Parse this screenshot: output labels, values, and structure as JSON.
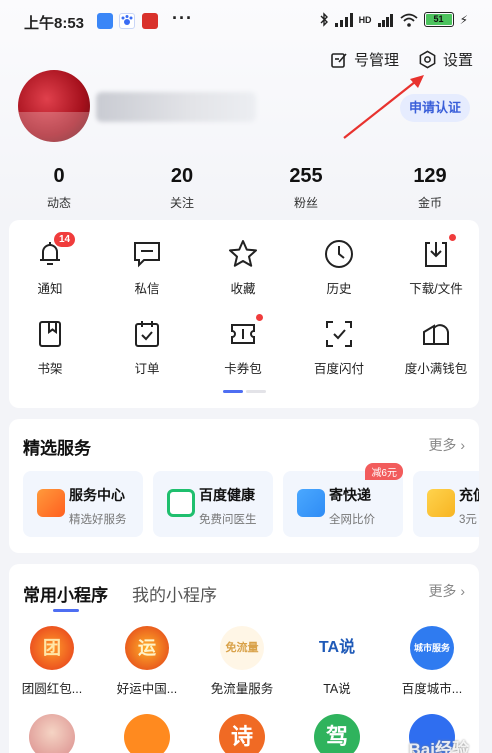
{
  "status_bar": {
    "time": "上午8:53",
    "dots": "···",
    "battery": "51",
    "network": "HD"
  },
  "header": {
    "account_manage": "号管理",
    "settings": "设置",
    "verify_button": "申请认证"
  },
  "stats": [
    {
      "num": "0",
      "label": "动态"
    },
    {
      "num": "20",
      "label": "关注"
    },
    {
      "num": "255",
      "label": "粉丝"
    },
    {
      "num": "129",
      "label": "金币"
    }
  ],
  "grid": [
    {
      "label": "通知",
      "icon": "bell-icon",
      "badge": "14"
    },
    {
      "label": "私信",
      "icon": "message-icon"
    },
    {
      "label": "收藏",
      "icon": "star-icon"
    },
    {
      "label": "历史",
      "icon": "clock-icon"
    },
    {
      "label": "下载/文件",
      "icon": "download-icon",
      "dot": true
    },
    {
      "label": "书架",
      "icon": "bookmark-icon"
    },
    {
      "label": "订单",
      "icon": "order-icon"
    },
    {
      "label": "卡券包",
      "icon": "coupon-icon",
      "dot": true
    },
    {
      "label": "百度闪付",
      "icon": "scan-pay-icon"
    },
    {
      "label": "度小满钱包",
      "icon": "wallet-icon"
    }
  ],
  "services": {
    "title": "精选服务",
    "more": "更多",
    "items": [
      {
        "title": "服务中心",
        "sub": "精选好服务",
        "color": "#ff7a1a"
      },
      {
        "title": "百度健康",
        "sub": "免费问医生",
        "color": "#1fbf6e"
      },
      {
        "title": "寄快递",
        "sub": "全网比价",
        "color": "#2f8cf5",
        "badge": "减6元"
      },
      {
        "title": "充值",
        "sub": "3元",
        "color": "#f7b422"
      }
    ]
  },
  "mini_programs": {
    "tab_common": "常用小程序",
    "tab_mine": "我的小程序",
    "more": "更多",
    "items": [
      {
        "label": "团圆红包...",
        "text": "团"
      },
      {
        "label": "好运中国...",
        "text": "运"
      },
      {
        "label": "免流量服务",
        "text": "免流量"
      },
      {
        "label": "TA说",
        "text": "TA说"
      },
      {
        "label": "百度城市...",
        "text": "城市服务"
      }
    ],
    "row2": [
      "",
      "",
      "诗",
      "驾",
      ""
    ]
  },
  "watermark": "Bai经验"
}
